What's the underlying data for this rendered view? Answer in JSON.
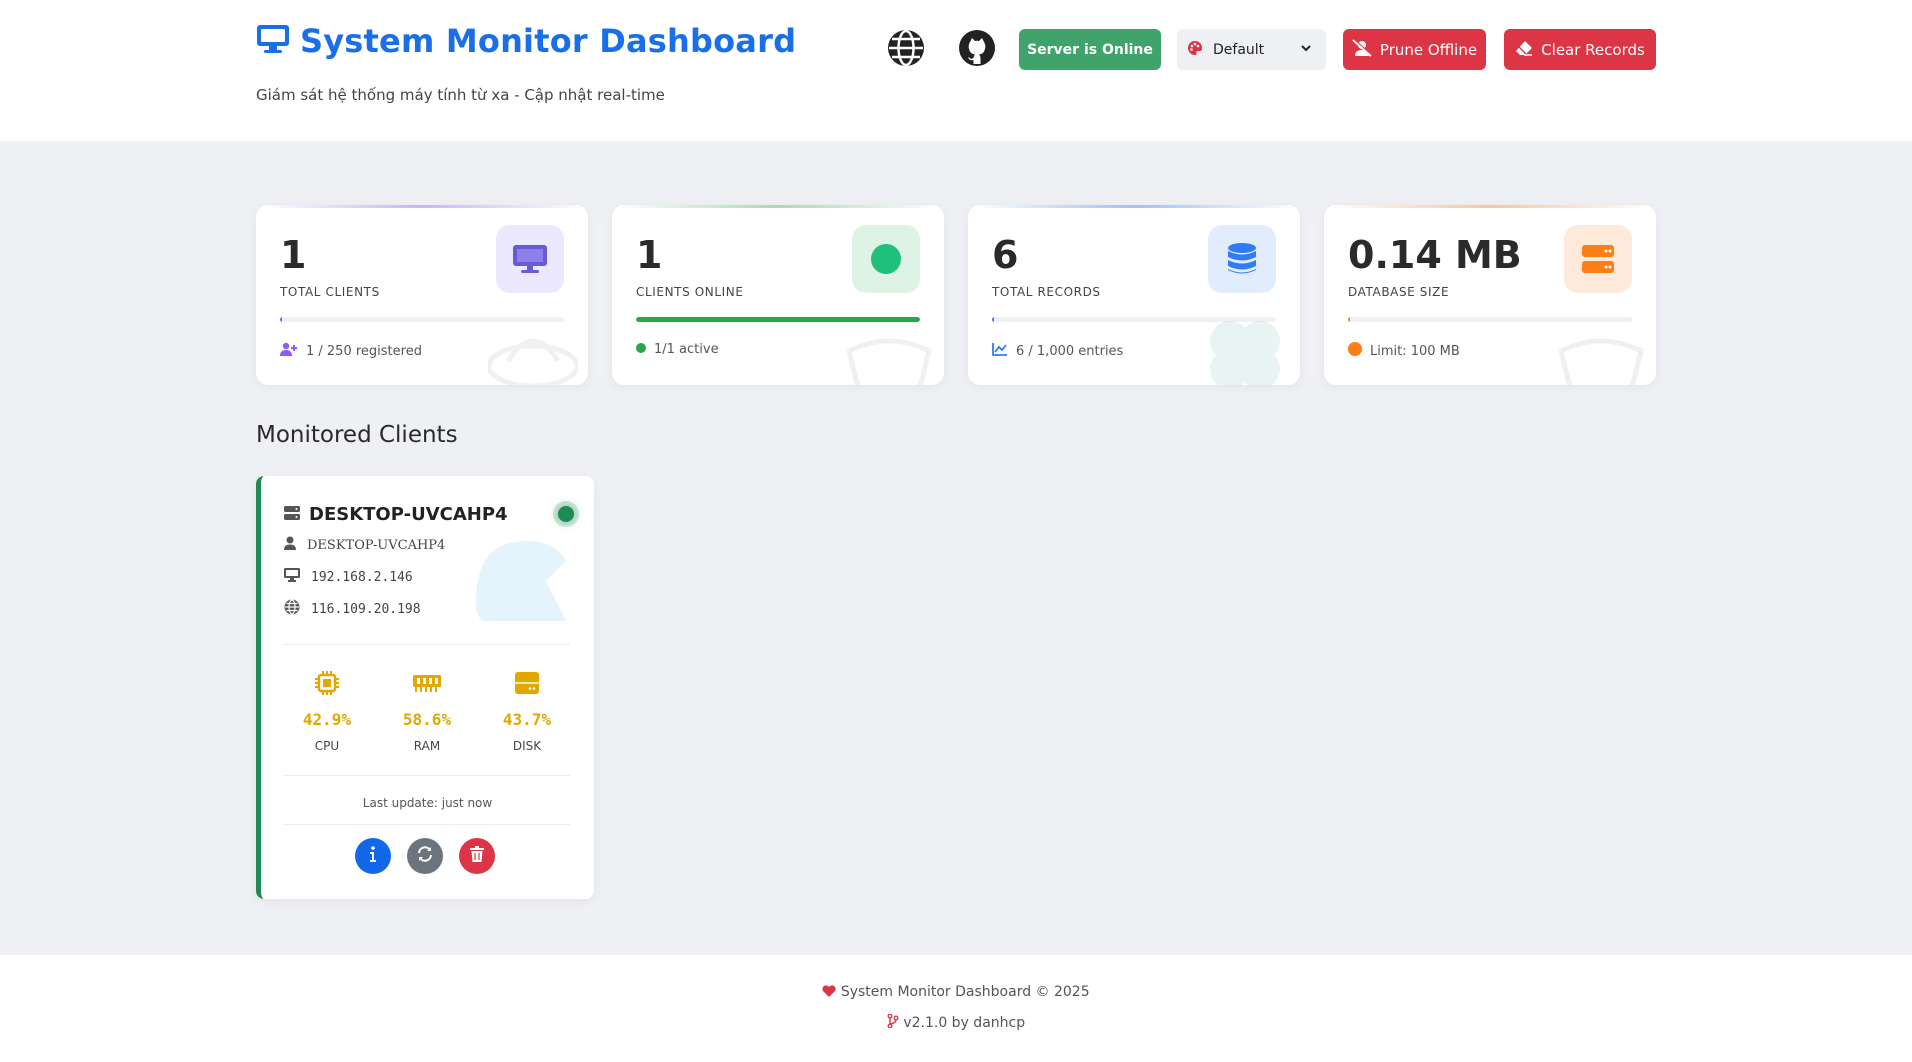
{
  "header": {
    "title": "System Monitor Dashboard",
    "subtitle": "Giám sát hệ thống máy tính từ xa - Cập nhật real-time",
    "globe_icon": "globe-icon",
    "github_icon": "github-icon",
    "server_status_label": "Server is Online",
    "theme_select_value": "Default",
    "prune_label": "Prune Offline",
    "clear_label": "Clear Records",
    "colors": {
      "brand": "#1a6fe8",
      "online": "#3fa36b",
      "danger": "#dc3545"
    }
  },
  "stats": [
    {
      "value": "1",
      "label": "TOTAL CLIENTS",
      "foot": "1 / 250 registered",
      "progress": 0.004,
      "color": "#8b5cf6",
      "icon": "monitor-icon"
    },
    {
      "value": "1",
      "label": "CLIENTS ONLINE",
      "foot": "1/1 active",
      "progress": 1.0,
      "color": "#28a745",
      "icon": "online-dot-icon"
    },
    {
      "value": "6",
      "label": "TOTAL RECORDS",
      "foot": "6 / 1,000 entries",
      "progress": 0.006,
      "color": "#2f7cf6",
      "icon": "database-icon"
    },
    {
      "value": "0.14 MB",
      "label": "DATABASE SIZE",
      "foot": "Limit: 100 MB",
      "progress": 0.0014,
      "color": "#fd7e14",
      "icon": "server-icon"
    }
  ],
  "clients_section": {
    "title": "Monitored Clients",
    "clients": [
      {
        "hostname": "DESKTOP-UVCAHP4",
        "user": "DESKTOP-UVCAHP4",
        "local_ip": "192.168.2.146",
        "public_ip": "116.109.20.198",
        "status": "online",
        "metrics": [
          {
            "value": "42.9%",
            "label": "CPU",
            "icon": "cpu-icon"
          },
          {
            "value": "58.6%",
            "label": "RAM",
            "icon": "ram-icon"
          },
          {
            "value": "43.7%",
            "label": "DISK",
            "icon": "disk-icon"
          }
        ],
        "last_update": "Last update: just now",
        "actions": [
          "info-button",
          "refresh-button",
          "delete-button"
        ]
      }
    ]
  },
  "footer": {
    "line1": "System Monitor Dashboard © 2025",
    "line2": "v2.1.0 by danhcp"
  }
}
